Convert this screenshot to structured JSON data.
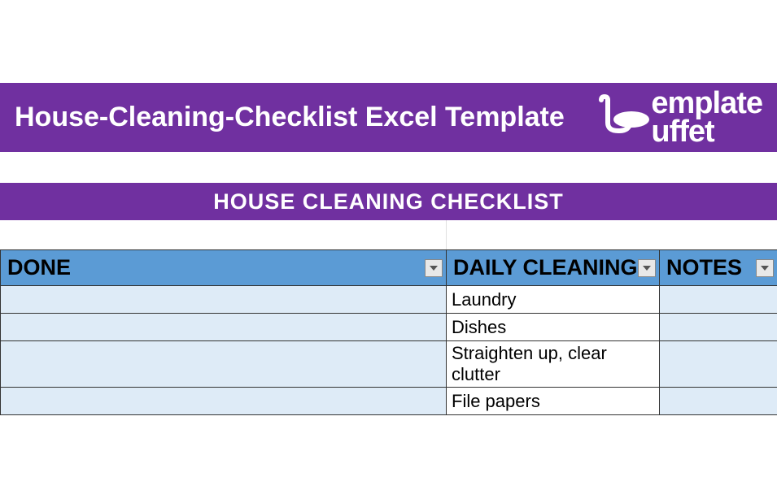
{
  "title_banner": {
    "text": "House-Cleaning-Checklist Excel Template",
    "logo_top": "emplate",
    "logo_bottom": "uffet"
  },
  "subtitle": "HOUSE CLEANING CHECKLIST",
  "table": {
    "headers": {
      "done": "DONE",
      "daily": "DAILY CLEANING",
      "notes": "NOTES"
    },
    "rows": [
      {
        "done": "",
        "task": "Laundry",
        "notes": ""
      },
      {
        "done": "",
        "task": "Dishes",
        "notes": ""
      },
      {
        "done": "",
        "task": "Straighten up, clear clutter",
        "notes": ""
      },
      {
        "done": "",
        "task": "File papers",
        "notes": ""
      }
    ]
  }
}
